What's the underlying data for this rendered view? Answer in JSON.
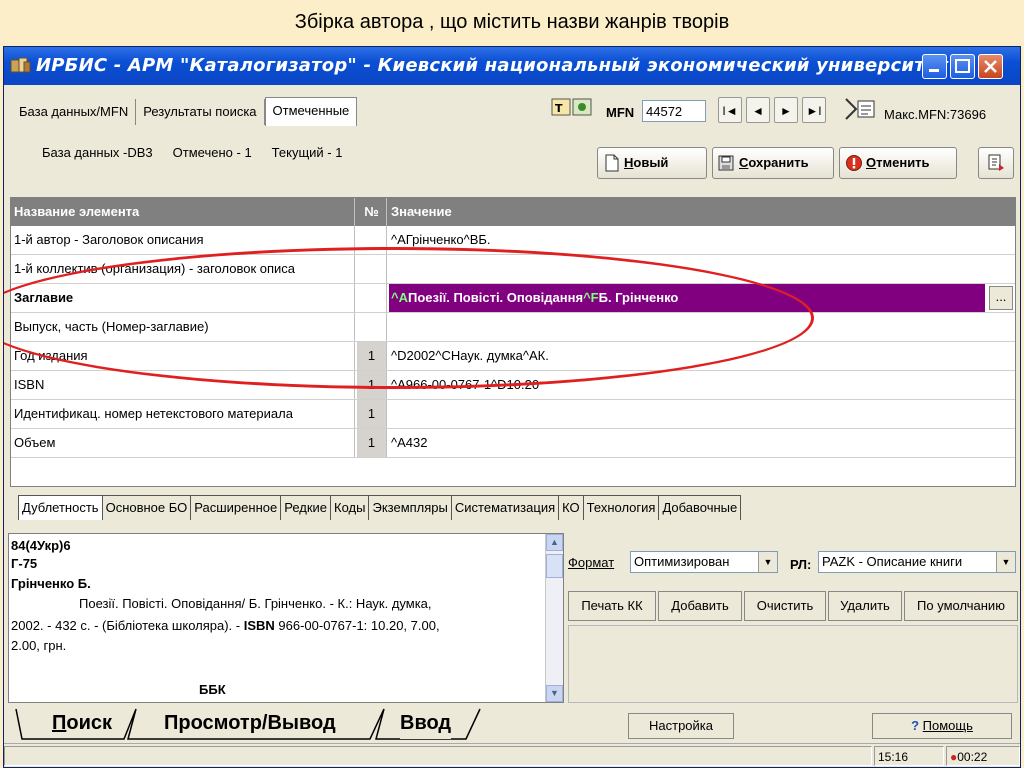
{
  "caption": "Збірка автора , що містить назви жанрів творів",
  "window": {
    "title": "ИРБИС - АРМ \"Каталогизатор\" - Киевский национальный экономический университет",
    "icon": "app-icon"
  },
  "top_tabs": [
    "База данных/MFN",
    "Результаты поиска",
    "Отмеченные"
  ],
  "status": {
    "database": "База данных -DB3",
    "marked": "Отмечено - 1",
    "current": "Текущий - 1"
  },
  "mfn": {
    "label": "MFN",
    "value": "44572",
    "max": "Макс.MFN:73696"
  },
  "nav": {
    "first": "I◄",
    "prev": "◄",
    "next": "►",
    "last": "►I"
  },
  "actions": {
    "new_prefix": "Н",
    "new_rest": "овый",
    "save_prefix": "С",
    "save_rest": "охранить",
    "cancel_prefix": "О",
    "cancel_rest": "тменить"
  },
  "grid": {
    "headers": {
      "name": "Название элемента",
      "num": "№",
      "value": "Значение"
    },
    "rows": [
      {
        "name": "1-й автор - Заголовок описания",
        "num": "",
        "value": "^AГрінченко^BБ."
      },
      {
        "name": "1-й коллектив (организация) - заголовок описа",
        "num": "",
        "value": ""
      },
      {
        "name": "Заглавие",
        "num": "",
        "value_parts": [
          "^",
          "A",
          "Поезії.  Повісті. Оповідання",
          "^",
          "F",
          "Б. Грінченко"
        ],
        "ellipsis": "..."
      },
      {
        "name": "Выпуск, часть (Номер-заглавие)",
        "num": "",
        "value": ""
      },
      {
        "name": "Год издания",
        "num": "1",
        "value": "^D2002^CНаук. думка^AК."
      },
      {
        "name": "ISBN",
        "num": "1",
        "value": "^A966-00-0767-1^D10.20"
      },
      {
        "name": "Идентификац. номер нетекстового материала",
        "num": "1",
        "value": ""
      },
      {
        "name": "Объем",
        "num": "1",
        "value": "^A432"
      }
    ]
  },
  "sub_tabs": [
    "Дублетность",
    "Основное БО",
    "Расширенное",
    "Редкие",
    "Коды",
    "Экземпляры",
    "Систематизация",
    "КО",
    "Технология",
    "Добавочные"
  ],
  "preview": {
    "line1": "84(4Укр)6",
    "line2": "Г-75",
    "line3": "Грінченко Б.",
    "line4": "Поезії. Повісті. Оповідання/ Б. Грінченко. - К.: Наук. думка,",
    "line5a": "2002. - 432 с. - (Бібліотека школяра). - ",
    "line5b": "ISBN",
    "line5c": " 966-00-0767-1: 10.20, 7.00,",
    "line6": "2.00, грн.",
    "line7": "ББК"
  },
  "format": {
    "label": "Формат",
    "value": "Оптимизирован",
    "rl_label": "РЛ:",
    "rl_value": "PAZK - Описание книги"
  },
  "print_buttons": [
    "Печать КК",
    "Добавить",
    "Очистить",
    "Удалить",
    "По умолчанию"
  ],
  "bottom_tabs": {
    "search_prefix": "П",
    "search_rest": "оиск",
    "view": "Просмотр/Вывод",
    "input": "Ввод"
  },
  "settings_button": "Настройка",
  "help_button": "Помощь",
  "statusbar": {
    "time1": "15:16",
    "time2": "00:22"
  },
  "colors": {
    "selected_row": "#800080",
    "annotation": "#e02020",
    "title_bar": "#0a4fd4"
  }
}
